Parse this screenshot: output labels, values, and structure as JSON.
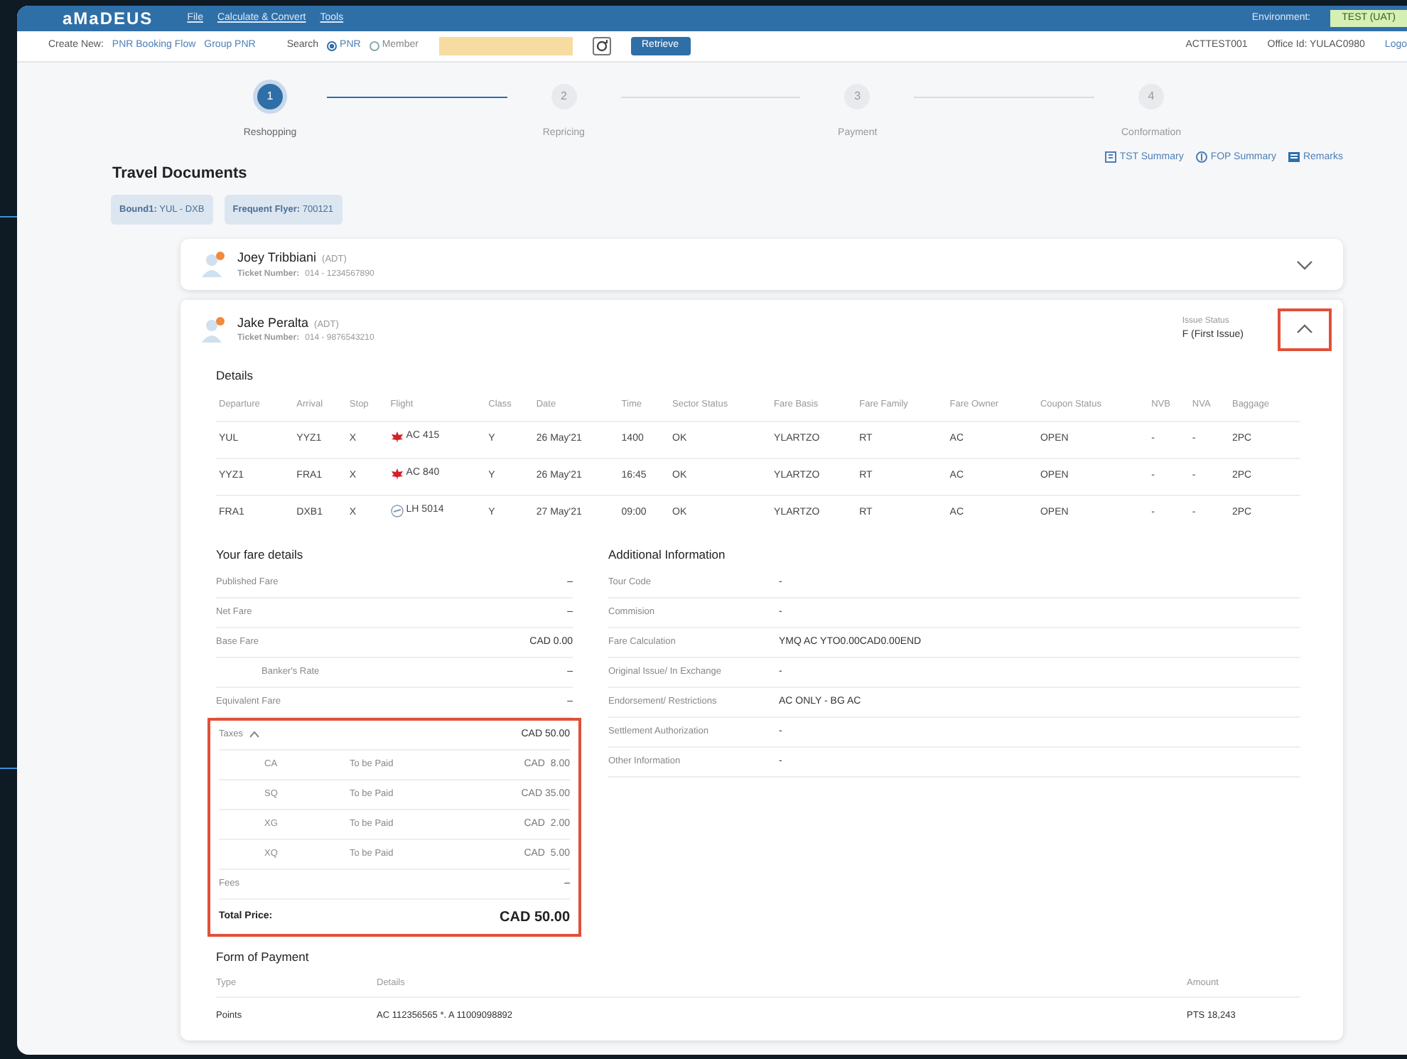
{
  "header": {
    "logo": "aMaDEUS",
    "menu": [
      "File",
      "Calculate & Convert",
      "Tools"
    ],
    "environment_label": "Environment:",
    "environment": "TEST (UAT)"
  },
  "toolbar": {
    "create_new_label": "Create New:",
    "create_links": [
      "PNR Booking Flow",
      "Group PNR"
    ],
    "search_label": "Search",
    "search_options": [
      {
        "label": "PNR",
        "selected": true
      },
      {
        "label": "Member",
        "selected": false
      }
    ],
    "retrieve_button": "Retrieve",
    "user": "ACTTEST001",
    "office": "Office Id: YULAC0980",
    "logout": "Logo"
  },
  "stepper": [
    {
      "number": "1",
      "label": "Reshopping",
      "selected": true
    },
    {
      "number": "2",
      "label": "Repricing",
      "selected": false
    },
    {
      "number": "3",
      "label": "Payment",
      "selected": false
    },
    {
      "number": "4",
      "label": "Conformation",
      "selected": false
    }
  ],
  "summary_links": [
    {
      "kind": "tst",
      "label": "TST Summary"
    },
    {
      "kind": "fop",
      "label": "FOP Summary"
    },
    {
      "kind": "remarks",
      "label": "Remarks"
    }
  ],
  "section_title": "Travel Documents",
  "chips": [
    {
      "label": "Bound1:",
      "value": "YUL - DXB"
    },
    {
      "label": "Frequent Flyer:",
      "value": "700121"
    }
  ],
  "passengers": [
    {
      "name": "Joey Tribbiani",
      "type": "(ADT)",
      "ticket_label": "Ticket Number:",
      "ticket": "014 - 1234567890",
      "expanded": false,
      "toggle_highlighted": false
    },
    {
      "name": "Jake Peralta",
      "type": "(ADT)",
      "ticket_label": "Ticket Number:",
      "ticket": "014 - 9876543210",
      "issue_status_label": "Issue Status",
      "issue_status": "F (First Issue)",
      "expanded": true,
      "toggle_highlighted": true
    }
  ],
  "details": {
    "title": "Details",
    "columns": [
      "Departure",
      "Arrival",
      "Stop",
      "Flight",
      "Class",
      "Date",
      "Time",
      "Sector Status",
      "Fare Basis",
      "Fare Family",
      "Fare Owner",
      "Coupon Status",
      "NVB",
      "NVA",
      "Baggage"
    ],
    "rows": [
      {
        "kind": "maple",
        "cells": [
          "YUL",
          "YYZ1",
          "X",
          "AC 415",
          "Y",
          "26 May'21",
          "1400",
          "OK",
          "YLARTZO",
          "RT",
          "AC",
          "OPEN",
          "-",
          "-",
          "2PC"
        ]
      },
      {
        "kind": "maple",
        "cells": [
          "YYZ1",
          "FRA1",
          "X",
          "AC 840",
          "Y",
          "26 May'21",
          "16:45",
          "OK",
          "YLARTZO",
          "RT",
          "AC",
          "OPEN",
          "-",
          "-",
          "2PC"
        ]
      },
      {
        "kind": "crane",
        "cells": [
          "FRA1",
          "DXB1",
          "X",
          "LH 5014",
          "Y",
          "27 May'21",
          "09:00",
          "OK",
          "YLARTZO",
          "RT",
          "AC",
          "OPEN",
          "-",
          "-",
          "2PC"
        ]
      }
    ]
  },
  "fare_details": {
    "title": "Your fare details",
    "highlighted": true,
    "rows": [
      {
        "kind": "line",
        "label": "Published Fare",
        "value": "–"
      },
      {
        "kind": "line",
        "label": "Net Fare",
        "value": "–"
      },
      {
        "kind": "line",
        "label": "Base Fare",
        "value": "CAD 0.00"
      },
      {
        "kind": "sub",
        "label": "Banker's Rate",
        "value": "–"
      },
      {
        "kind": "line",
        "label": "Equivalent Fare",
        "value": "–"
      },
      {
        "kind": "taxes",
        "label": "Taxes",
        "value": "CAD 50.00",
        "expanded": true,
        "children": [
          {
            "code": "CA",
            "status": "To be Paid",
            "amount": "CAD  8.00"
          },
          {
            "code": "SQ",
            "status": "To be Paid",
            "amount": "CAD 35.00"
          },
          {
            "code": "XG",
            "status": "To be Paid",
            "amount": "CAD  2.00"
          },
          {
            "code": "XQ",
            "status": "To be Paid",
            "amount": "CAD  5.00"
          }
        ]
      },
      {
        "kind": "line",
        "label": "Fees",
        "value": "–"
      },
      {
        "kind": "total",
        "label": "Total Price:",
        "value": "CAD 50.00"
      }
    ]
  },
  "additional_info": {
    "title": "Additional Information",
    "rows": [
      {
        "label": "Tour Code",
        "value": "-"
      },
      {
        "label": "Commision",
        "value": "-"
      },
      {
        "label": "Fare Calculation",
        "value": "YMQ AC YTO0.00CAD0.00END"
      },
      {
        "label": "Original Issue/ In Exchange",
        "value": "-"
      },
      {
        "label": "Endorsement/ Restrictions",
        "value": "AC ONLY - BG AC"
      },
      {
        "label": "Settlement Authorization",
        "value": "-"
      },
      {
        "label": "Other Information",
        "value": "-"
      }
    ]
  },
  "payment": {
    "title": "Form of Payment",
    "columns": [
      "Type",
      "Details",
      "Amount"
    ],
    "rows": [
      [
        "Points",
        "AC 112356565 *. A 11009098892",
        "PTS 18,243"
      ]
    ]
  }
}
